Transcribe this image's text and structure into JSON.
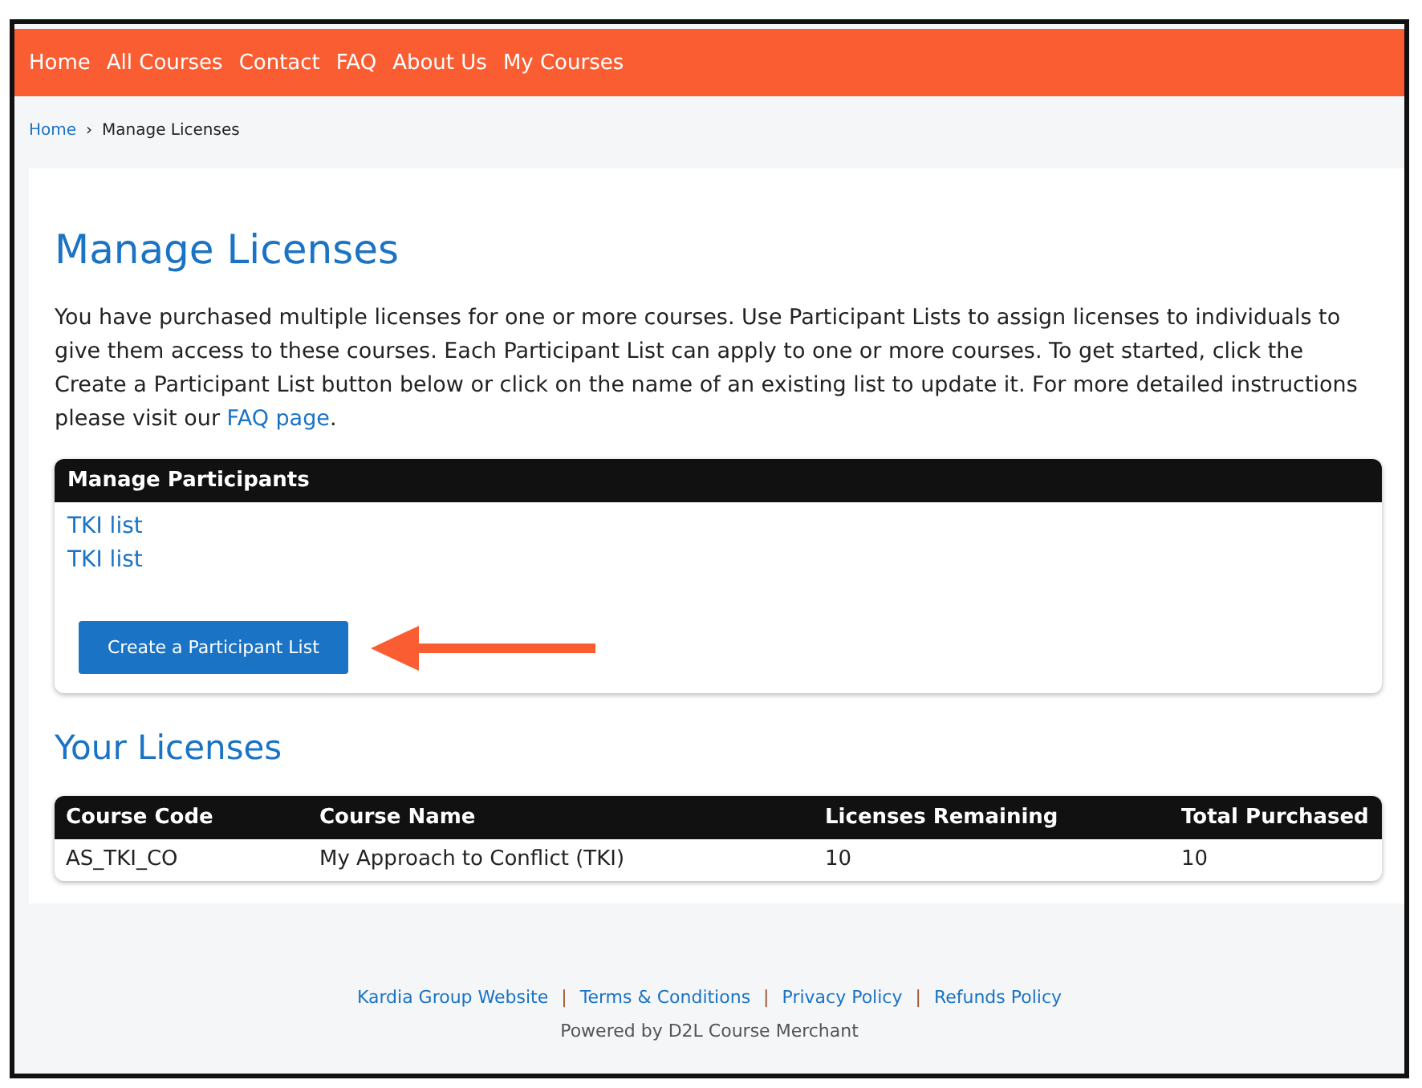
{
  "nav": [
    "Home",
    "All Courses",
    "Contact",
    "FAQ",
    "About Us",
    "My Courses"
  ],
  "breadcrumb": {
    "link": "Home",
    "separator": "›",
    "current": "Manage Licenses"
  },
  "title": "Manage Licenses",
  "intro": {
    "text": "You have purchased multiple licenses for one or more courses. Use Participant Lists to assign licenses to individuals to give them access to these courses. Each Participant List can apply to one or more courses. To get started, click the Create a Participant List button below or click on the name of an existing list to update it. For more detailed instructions please visit our ",
    "link": "FAQ page",
    "end": "."
  },
  "participants": {
    "header": "Manage Participants",
    "lists": [
      "TKI list",
      "TKI list"
    ],
    "button": "Create a Participant List"
  },
  "licenses": {
    "title": "Your Licenses",
    "columns": [
      "Course Code",
      "Course Name",
      "Licenses Remaining",
      "Total Purchased"
    ],
    "rows": [
      [
        "AS_TKI_CO",
        "My Approach to Conflict (TKI)",
        "10",
        "10"
      ]
    ]
  },
  "footer": {
    "links": [
      "Kardia Group Website",
      "Terms & Conditions",
      "Privacy Policy",
      "Refunds Policy"
    ],
    "separator": "|",
    "powered": "Powered by D2L Course Merchant"
  }
}
